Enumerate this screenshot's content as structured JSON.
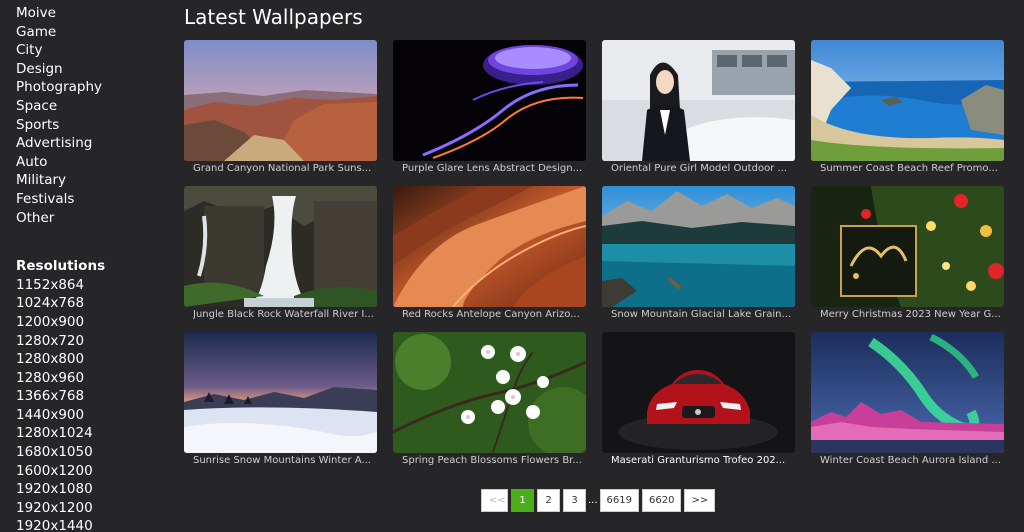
{
  "sidebar": {
    "categories": [
      "Moive",
      "Game",
      "City",
      "Design",
      "Photography",
      "Space",
      "Sports",
      "Advertising",
      "Auto",
      "Military",
      "Festivals",
      "Other"
    ],
    "resolutions_heading": "Resolutions",
    "resolutions": [
      "1152x864",
      "1024x768",
      "1200x900",
      "1280x720",
      "1280x800",
      "1280x960",
      "1366x768",
      "1440x900",
      "1280x1024",
      "1680x1050",
      "1600x1200",
      "1920x1080",
      "1920x1200",
      "1920x1440"
    ]
  },
  "main": {
    "title": "Latest Wallpapers",
    "wallpapers": [
      {
        "caption": "Grand Canyon National Park Suns...",
        "icon": "canyon-sunset-image"
      },
      {
        "caption": "Purple Glare Lens Abstract Design...",
        "icon": "purple-lens-image"
      },
      {
        "caption": "Oriental Pure Girl Model Outdoor ...",
        "icon": "girl-model-image"
      },
      {
        "caption": "Summer Coast Beach Reef Promo...",
        "icon": "coast-beach-image"
      },
      {
        "caption": "Jungle Black Rock Waterfall River I...",
        "icon": "waterfall-image"
      },
      {
        "caption": "Red Rocks Antelope Canyon Arizo...",
        "icon": "antelope-canyon-image"
      },
      {
        "caption": "Snow Mountain Glacial Lake Grain...",
        "icon": "glacial-lake-image"
      },
      {
        "caption": "Merry Christmas 2023 New Year G...",
        "icon": "christmas-image"
      },
      {
        "caption": "Sunrise Snow Mountains Winter A...",
        "icon": "snow-sunrise-image"
      },
      {
        "caption": "Spring Peach Blossoms Flowers Br...",
        "icon": "peach-blossom-image"
      },
      {
        "caption": "Maserati Granturismo Trofeo 202...",
        "icon": "red-car-image"
      },
      {
        "caption": "Winter Coast Beach Aurora Island ...",
        "icon": "aurora-image"
      }
    ]
  },
  "pagination": {
    "prev": "<<",
    "pages": [
      "1",
      "2",
      "3"
    ],
    "ellipsis": "...",
    "tail_pages": [
      "6619",
      "6620"
    ],
    "next": ">>",
    "active_page": "1"
  },
  "colors": {
    "background": "#262629",
    "active_page": "#4caf1a"
  }
}
